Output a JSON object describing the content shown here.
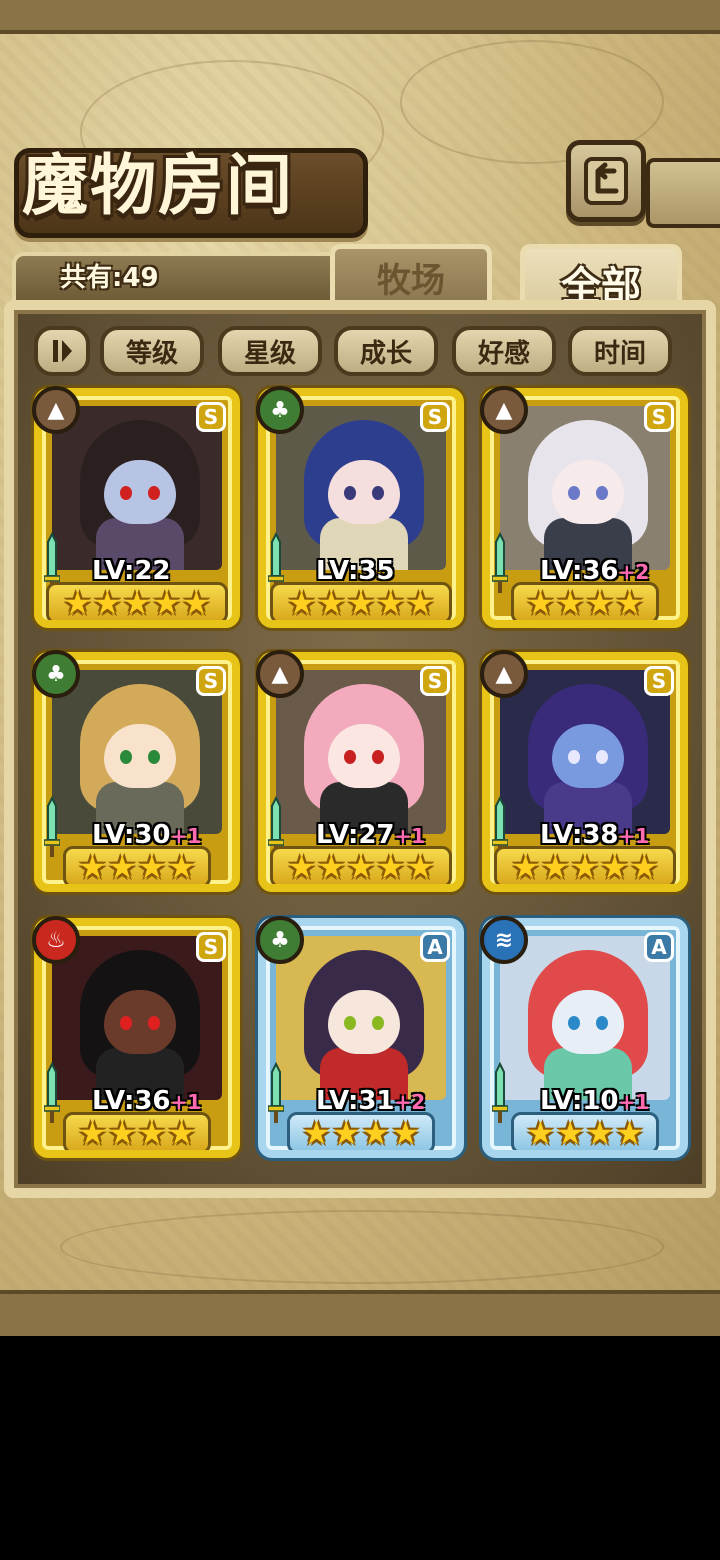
{
  "title": "魔物房间",
  "count_label": "共有:49",
  "tabs": {
    "ranch": "牧场",
    "all": "全部",
    "active": "全部"
  },
  "sort_buttons": [
    "等级",
    "星级",
    "成长",
    "好感",
    "时间"
  ],
  "back_icon": "back-arrow-icon",
  "monsters": [
    {
      "element": "earth",
      "rank": "S",
      "level": "LV:22",
      "bonus": "",
      "stars": 5
    },
    {
      "element": "leaf",
      "rank": "S",
      "level": "LV:35",
      "bonus": "",
      "stars": 5
    },
    {
      "element": "earth",
      "rank": "S",
      "level": "LV:36",
      "bonus": "+2",
      "stars": 4
    },
    {
      "element": "leaf",
      "rank": "S",
      "level": "LV:30",
      "bonus": "+1",
      "stars": 4
    },
    {
      "element": "earth",
      "rank": "S",
      "level": "LV:27",
      "bonus": "+1",
      "stars": 5
    },
    {
      "element": "earth",
      "rank": "S",
      "level": "LV:38",
      "bonus": "+1",
      "stars": 5
    },
    {
      "element": "fire",
      "rank": "S",
      "level": "LV:36",
      "bonus": "+1",
      "stars": 4
    },
    {
      "element": "leaf",
      "rank": "A",
      "level": "LV:31",
      "bonus": "+2",
      "stars": 4
    },
    {
      "element": "water",
      "rank": "A",
      "level": "LV:10",
      "bonus": "+1",
      "stars": 4
    }
  ],
  "colors": {
    "gold_frame": "#e8c418",
    "blue_frame": "#a8d6ee",
    "bonus_pink": "#ff6ab0"
  }
}
